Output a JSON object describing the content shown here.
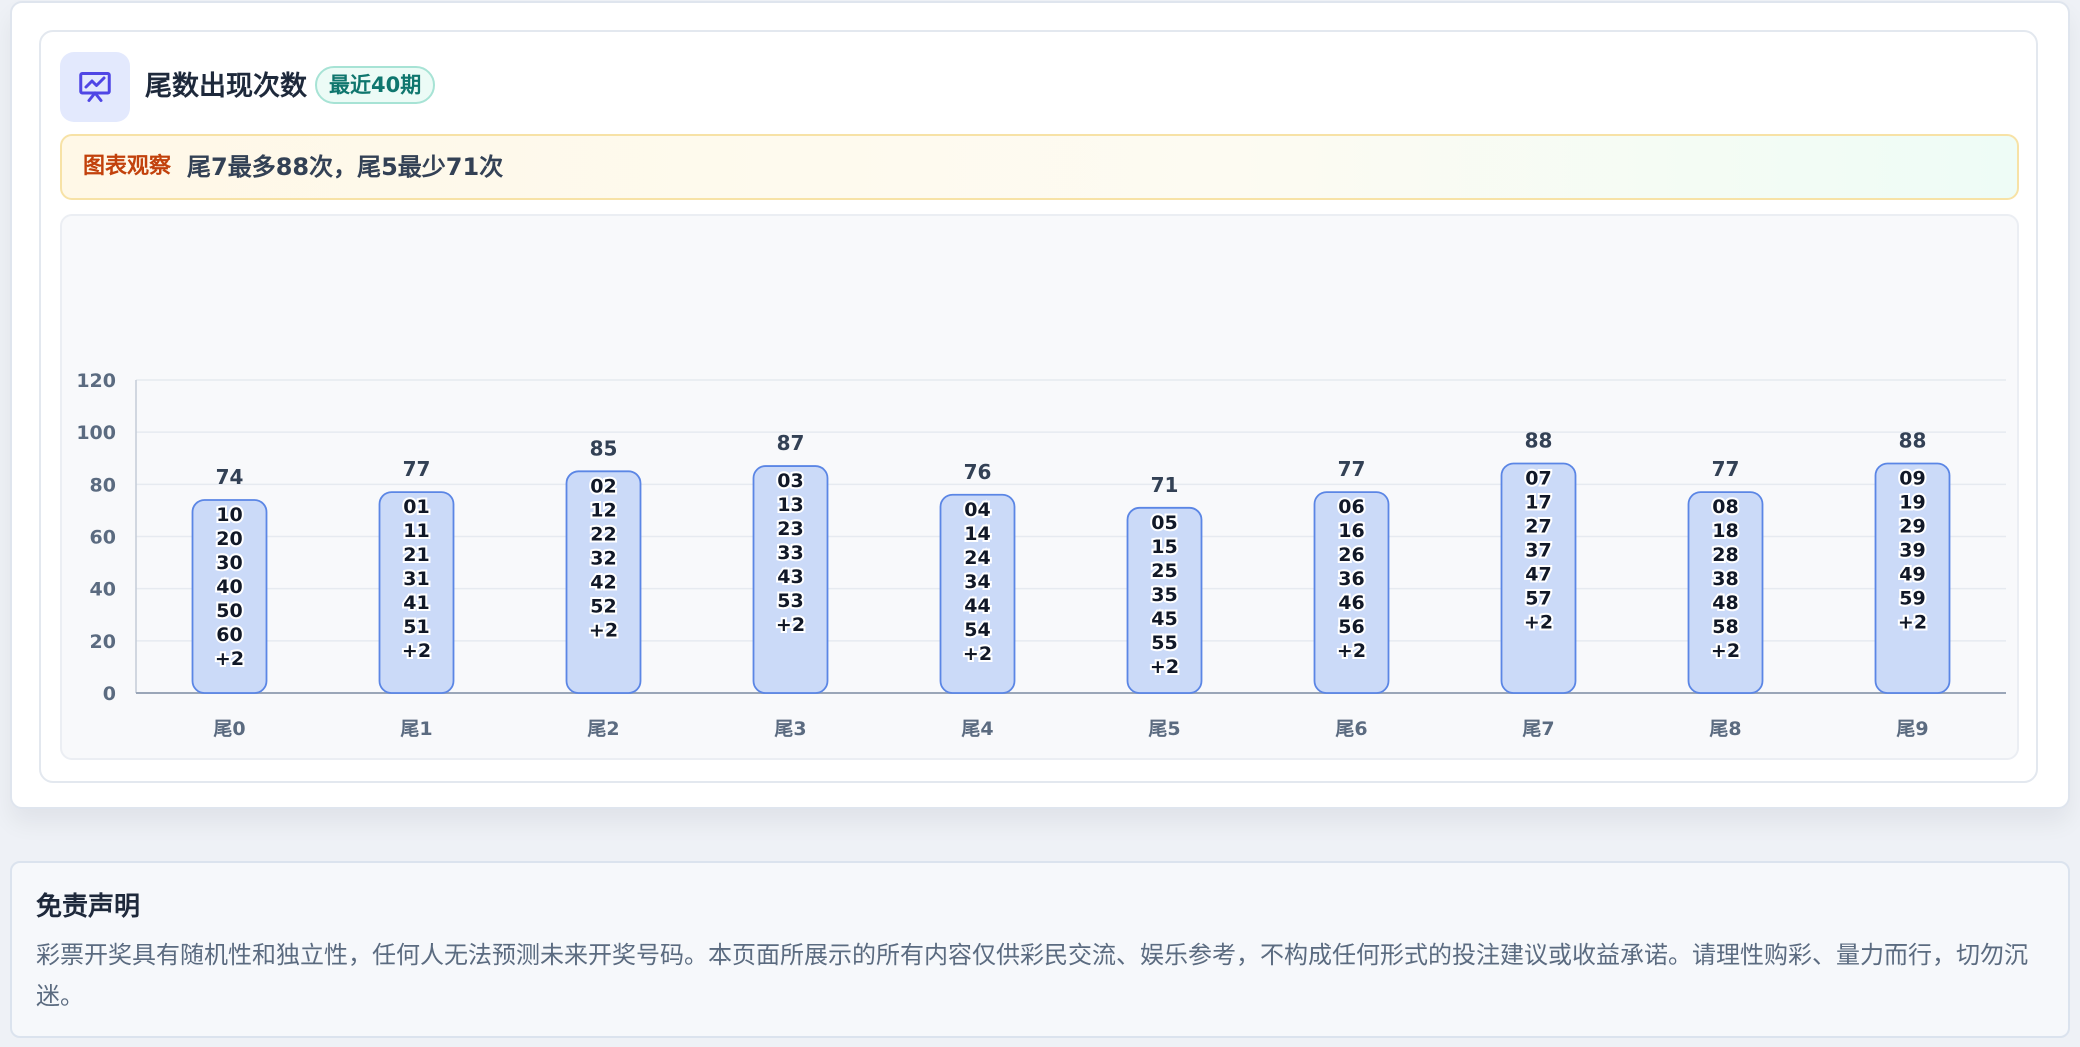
{
  "header": {
    "title": "尾数出现次数",
    "badge": "最近40期",
    "icon": "chart-presentation-icon"
  },
  "insight": {
    "label": "图表观察",
    "text": "尾7最多88次，尾5最少71次"
  },
  "colors": {
    "bar_fill": "#cbdaf8",
    "bar_stroke": "#5b86e5",
    "accent": "#4f46e5",
    "badge_text": "#0f766e",
    "insight_label": "#c2410c"
  },
  "chart_data": {
    "type": "bar",
    "categories": [
      "尾0",
      "尾1",
      "尾2",
      "尾3",
      "尾4",
      "尾5",
      "尾6",
      "尾7",
      "尾8",
      "尾9"
    ],
    "values": [
      74,
      77,
      85,
      87,
      76,
      71,
      77,
      88,
      77,
      88
    ],
    "ylim": [
      0,
      120
    ],
    "yticks": [
      0,
      20,
      40,
      60,
      80,
      100,
      120
    ],
    "grid": true,
    "bar_labels": [
      [
        "10",
        "20",
        "30",
        "40",
        "50",
        "60",
        "+2"
      ],
      [
        "01",
        "11",
        "21",
        "31",
        "41",
        "51",
        "+2"
      ],
      [
        "02",
        "12",
        "22",
        "32",
        "42",
        "52",
        "+2"
      ],
      [
        "03",
        "13",
        "23",
        "33",
        "43",
        "53",
        "+2"
      ],
      [
        "04",
        "14",
        "24",
        "34",
        "44",
        "54",
        "+2"
      ],
      [
        "05",
        "15",
        "25",
        "35",
        "45",
        "55",
        "+2"
      ],
      [
        "06",
        "16",
        "26",
        "36",
        "46",
        "56",
        "+2"
      ],
      [
        "07",
        "17",
        "27",
        "37",
        "47",
        "57",
        "+2"
      ],
      [
        "08",
        "18",
        "28",
        "38",
        "48",
        "58",
        "+2"
      ],
      [
        "09",
        "19",
        "29",
        "39",
        "49",
        "59",
        "+2"
      ]
    ]
  },
  "disclaimer": {
    "title": "免责声明",
    "text": "彩票开奖具有随机性和独立性，任何人无法预测未来开奖号码。本页面所展示的所有内容仅供彩民交流、娱乐参考，不构成任何形式的投注建议或收益承诺。请理性购彩、量力而行，切勿沉迷。"
  }
}
